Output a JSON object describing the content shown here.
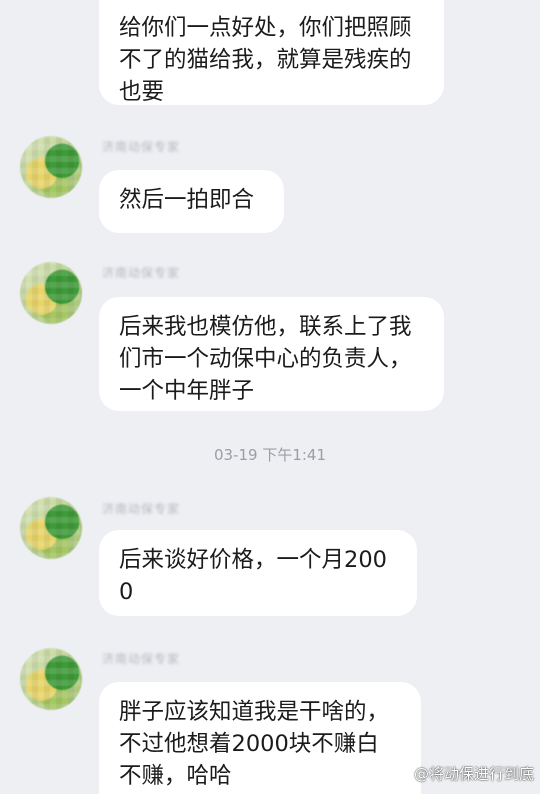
{
  "messages": [
    {
      "nickname": "",
      "text": "给你们一点好处，你们把照顾不了的猫给我，就算是残疾的也要"
    },
    {
      "nickname": "济南动保专家",
      "text": "然后一拍即合"
    },
    {
      "nickname": "济南动保专家",
      "text": "后来我也模仿他，联系上了我们市一个动保中心的负责人，一个中年胖子"
    },
    {
      "nickname": "济南动保专家",
      "text": "后来谈好价格，一个月2000"
    },
    {
      "nickname": "济南动保专家",
      "text": "胖子应该知道我是干啥的，不过他想着2000块不赚白不赚，哈哈"
    }
  ],
  "timestamp": "03-19 下午1:41",
  "watermark": {
    "text": "@将动保进行到底",
    "icon": "weibo-icon"
  }
}
